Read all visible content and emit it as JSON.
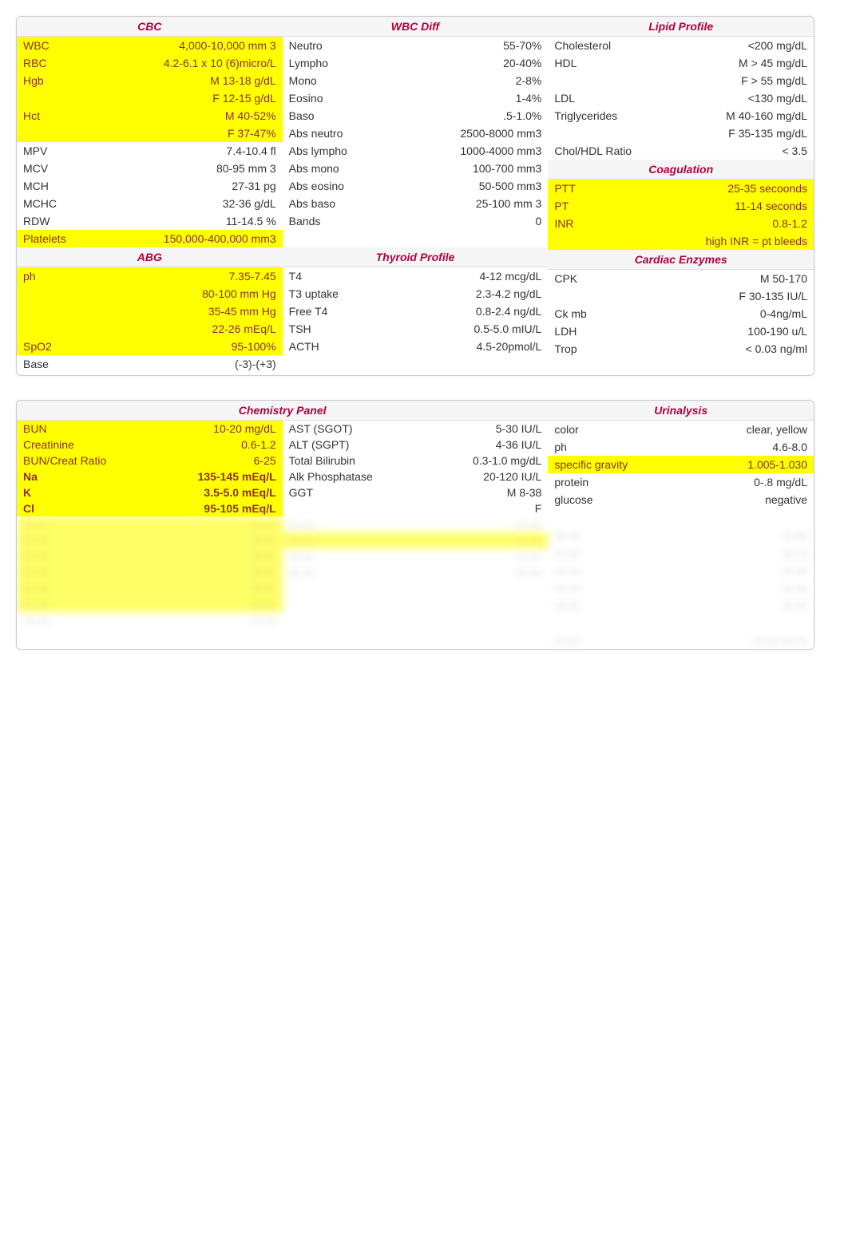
{
  "t1": {
    "cbc": {
      "title": "CBC",
      "rows": [
        {
          "l": "WBC",
          "v": "4,000-10,000 mm 3",
          "hl": true
        },
        {
          "l": "RBC",
          "v": "4.2-6.1 x 10 (6)micro/L",
          "hl": true
        },
        {
          "l": "Hgb",
          "v": "M 13-18 g/dL",
          "hl": true
        },
        {
          "l": "",
          "v": "F  12-15 g/dL",
          "hl": true
        },
        {
          "l": "Hct",
          "v": "M 40-52%",
          "hl": true
        },
        {
          "l": "",
          "v": "F  37-47%",
          "hl": true
        },
        {
          "l": "MPV",
          "v": "7.4-10.4 fl",
          "hl": false
        },
        {
          "l": "MCV",
          "v": "80-95 mm 3",
          "hl": false
        },
        {
          "l": "MCH",
          "v": "27-31 pg",
          "hl": false
        },
        {
          "l": "MCHC",
          "v": "32-36 g/dL",
          "hl": false
        },
        {
          "l": "RDW",
          "v": "11-14.5 %",
          "hl": false
        },
        {
          "l": "Platelets",
          "v": "150,000-400,000 mm3",
          "hl": true
        }
      ]
    },
    "wbcdiff": {
      "title": "WBC Diff",
      "rows": [
        {
          "l": "Neutro",
          "v": "55-70%",
          "hl": false
        },
        {
          "l": "Lympho",
          "v": "20-40%",
          "hl": false
        },
        {
          "l": "Mono",
          "v": "2-8%",
          "hl": false
        },
        {
          "l": "Eosino",
          "v": "1-4%",
          "hl": false
        },
        {
          "l": "Baso",
          "v": ".5-1.0%",
          "hl": false
        },
        {
          "l": "Abs neutro",
          "v": "2500-8000 mm3",
          "hl": false
        },
        {
          "l": "Abs lympho",
          "v": "1000-4000 mm3",
          "hl": false
        },
        {
          "l": "Abs mono",
          "v": "100-700 mm3",
          "hl": false
        },
        {
          "l": "Abs eosino",
          "v": "50-500 mm3",
          "hl": false
        },
        {
          "l": "Abs baso",
          "v": "25-100 mm 3",
          "hl": false
        },
        {
          "l": "Bands",
          "v": "0",
          "hl": false
        },
        {
          "l": "",
          "v": "",
          "hl": false
        }
      ]
    },
    "lipid": {
      "title": "Lipid Profile",
      "rows": [
        {
          "l": "Cholesterol",
          "v": "<200 mg/dL",
          "hl": false
        },
        {
          "l": "HDL",
          "v": "M > 45 mg/dL",
          "hl": false
        },
        {
          "l": "",
          "v": "F  > 55 mg/dL",
          "hl": false
        },
        {
          "l": "LDL",
          "v": "<130 mg/dL",
          "hl": false
        },
        {
          "l": "Triglycerides",
          "v": "M 40-160 mg/dL",
          "hl": false
        },
        {
          "l": "",
          "v": "F  35-135 mg/dL",
          "hl": false
        },
        {
          "l": "Chol/HDL Ratio",
          "v": "< 3.5",
          "hl": false
        }
      ]
    },
    "coag": {
      "title": "Coagulation",
      "rows": [
        {
          "l": "PTT",
          "v": "25-35 secoonds",
          "hl": true
        },
        {
          "l": "PT",
          "v": "11-14 seconds",
          "hl": true
        },
        {
          "l": "INR",
          "v": "0.8-1.2",
          "hl": true
        },
        {
          "l": "",
          "v": "high INR = pt bleeds",
          "hl": true
        }
      ]
    },
    "abg": {
      "title": "ABG",
      "rows": [
        {
          "l": "ph",
          "v": "7.35-7.45",
          "hl": true
        },
        {
          "l": "",
          "v": "80-100 mm Hg",
          "hl": true
        },
        {
          "l": "",
          "v": "35-45 mm Hg",
          "hl": true
        },
        {
          "l": "",
          "v": "22-26 mEq/L",
          "hl": true
        },
        {
          "l": "SpO2",
          "v": "95-100%",
          "hl": true
        },
        {
          "l": "Base",
          "v": "(-3)-(+3)",
          "hl": false
        }
      ]
    },
    "thyroid": {
      "title": "Thyroid Profile",
      "rows": [
        {
          "l": "T4",
          "v": "4-12 mcg/dL",
          "hl": false
        },
        {
          "l": "T3 uptake",
          "v": "2.3-4.2 ng/dL",
          "hl": false
        },
        {
          "l": "Free T4",
          "v": "0.8-2.4 ng/dL",
          "hl": false
        },
        {
          "l": "TSH",
          "v": "0.5-5.0 mIU/L",
          "hl": false
        },
        {
          "l": "ACTH",
          "v": "4.5-20pmol/L",
          "hl": false
        },
        {
          "l": "",
          "v": "",
          "hl": false
        }
      ]
    },
    "cardiac": {
      "title": "Cardiac Enzymes",
      "rows": [
        {
          "l": "CPK",
          "v": "M 50-170",
          "hl": false
        },
        {
          "l": "",
          "v": "F  30-135 IU/L",
          "hl": false
        },
        {
          "l": "Ck mb",
          "v": "0-4ng/mL",
          "hl": false
        },
        {
          "l": "LDH",
          "v": "100-190 u/L",
          "hl": false
        },
        {
          "l": "Trop",
          "v": "< 0.03 ng/ml",
          "hl": false
        },
        {
          "l": "",
          "v": "",
          "hl": false
        }
      ]
    }
  },
  "t2": {
    "chem": {
      "title": "Chemistry Panel",
      "rows": [
        {
          "l1": "BUN",
          "v1": "10-20 mg/dL",
          "hl1": true,
          "l2": "AST  (SGOT)",
          "v2": "5-30 IU/L",
          "hl2": false
        },
        {
          "l1": "Creatinine",
          "v1": "0.6-1.2",
          "hl1": true,
          "l2": "ALT (SGPT)",
          "v2": "4-36 IU/L",
          "hl2": false
        },
        {
          "l1": "BUN/Creat Ratio",
          "v1": "6-25",
          "hl1": true,
          "l2": "Total Bilirubin",
          "v2": "0.3-1.0 mg/dL",
          "hl2": false
        },
        {
          "l1": "Na",
          "v1": "135-145 mEq/L",
          "hl1": true,
          "bold1": true,
          "l2": "Alk Phosphatase",
          "v2": "20-120  IU/L",
          "hl2": false
        },
        {
          "l1": "K",
          "v1": "3.5-5.0 mEq/L",
          "hl1": true,
          "bold1": true,
          "l2": "GGT",
          "v2": "M 8-38",
          "hl2": false
        },
        {
          "l1": "Cl",
          "v1": "95-105 mEq/L",
          "hl1": true,
          "bold1": true,
          "l2": "",
          "v2": "F",
          "hl2": false
        }
      ]
    },
    "urine": {
      "title": "Urinalysis",
      "rows": [
        {
          "l": "color",
          "v": "clear, yellow",
          "hl": false
        },
        {
          "l": "ph",
          "v": "4.6-8.0",
          "hl": false
        },
        {
          "l": "specific gravity",
          "v": "1.005-1.030",
          "hl": true
        },
        {
          "l": "protein",
          "v": "0-.8 mg/dL",
          "hl": false
        },
        {
          "l": "glucose",
          "v": "negative",
          "hl": false
        },
        {
          "l": "",
          "v": "",
          "hl": false
        }
      ]
    }
  }
}
